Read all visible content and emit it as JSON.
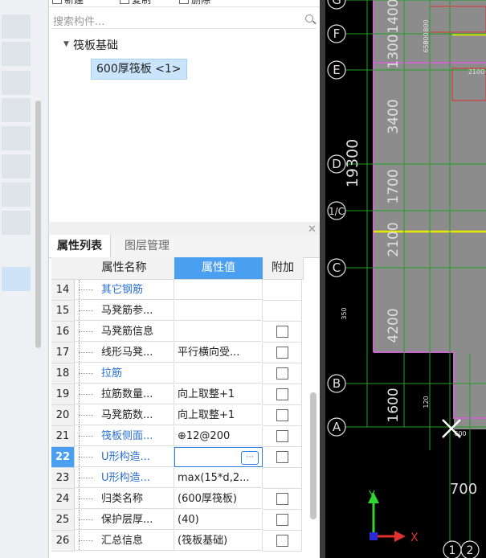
{
  "toolbar": {
    "new_label": "新建",
    "copy_label": "复制",
    "delete_label": "删除"
  },
  "search": {
    "placeholder": "搜索构件..."
  },
  "tree": {
    "group_label": "筏板基础",
    "item_label": "600厚筏板 <1>"
  },
  "tabs": {
    "properties": "属性列表",
    "layers": "图层管理"
  },
  "table": {
    "headers": {
      "name": "属性名称",
      "value": "属性值",
      "extra": "附加"
    },
    "rows": [
      {
        "num": "14",
        "name": "其它钢筋",
        "value": "",
        "blue": true,
        "checkbox": false
      },
      {
        "num": "15",
        "name": "马凳筋参...",
        "value": "",
        "blue": false,
        "checkbox": false
      },
      {
        "num": "16",
        "name": "马凳筋信息",
        "value": "",
        "blue": false,
        "checkbox": true
      },
      {
        "num": "17",
        "name": "线形马凳...",
        "value": "平行横向受...",
        "blue": false,
        "checkbox": true
      },
      {
        "num": "18",
        "name": "拉筋",
        "value": "",
        "blue": true,
        "checkbox": true
      },
      {
        "num": "19",
        "name": "拉筋数量...",
        "value": "向上取整+1",
        "blue": false,
        "checkbox": true
      },
      {
        "num": "20",
        "name": "马凳筋数...",
        "value": "向上取整+1",
        "blue": false,
        "checkbox": true
      },
      {
        "num": "21",
        "name": "筏板侧面...",
        "value": "⊕12@200",
        "blue": true,
        "checkbox": true
      },
      {
        "num": "22",
        "name": "U形构造...",
        "value": "",
        "blue": true,
        "checkbox": true,
        "selected": true
      },
      {
        "num": "23",
        "name": "U形构造...",
        "value": "max(15*d,2...",
        "blue": true,
        "checkbox": false
      },
      {
        "num": "24",
        "name": "归类名称",
        "value": "(600厚筏板)",
        "blue": false,
        "checkbox": true
      },
      {
        "num": "25",
        "name": "保护层厚...",
        "value": "(40)",
        "blue": false,
        "checkbox": true
      },
      {
        "num": "26",
        "name": "汇总信息",
        "value": "(筏板基础)",
        "blue": false,
        "checkbox": true
      }
    ]
  },
  "canvas": {
    "axes": [
      "G",
      "F",
      "E",
      "D",
      "1/C",
      "C",
      "B",
      "A"
    ],
    "dims": [
      "1400",
      "1300",
      "3400",
      "1700",
      "2100",
      "4200",
      "1600"
    ],
    "total_dim": "19300",
    "small_labels": [
      "800",
      "650",
      "800",
      "2100",
      "350",
      "120",
      "600"
    ],
    "bottom_dim": "700",
    "col_axes": [
      "1",
      "2"
    ],
    "ucs": {
      "x": "X",
      "y": "Y"
    },
    "colors": {
      "slab": "#8c8c8c",
      "highlight": "#c868c8",
      "grid": "#1fa01f",
      "dim": "#e0e0e0",
      "yellow": "#e8e800",
      "red": "#e03030"
    }
  }
}
